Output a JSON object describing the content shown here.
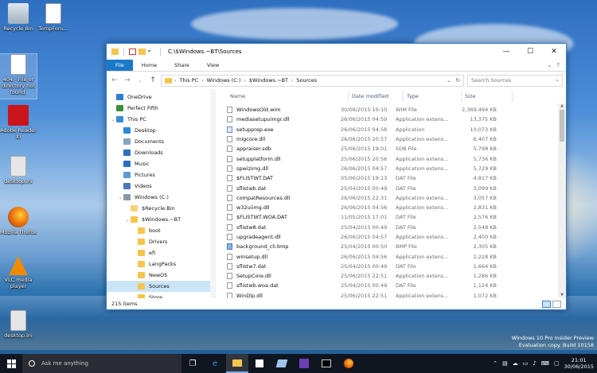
{
  "desktop": {
    "icons": [
      {
        "label": "Recycle Bin",
        "icon": "recycle-bin-icon"
      },
      {
        "label": "TempForu...",
        "icon": "text-document-icon"
      },
      {
        "label": "404 - File or directory not found.",
        "icon": "text-document-icon"
      },
      {
        "label": "Adobe Reader XI",
        "icon": "adobe-reader-icon"
      },
      {
        "label": "desktop.ini",
        "icon": "settings-file-icon"
      },
      {
        "label": "Mozilla Firefox",
        "icon": "firefox-icon"
      },
      {
        "label": "VLC media player",
        "icon": "vlc-icon"
      },
      {
        "label": "desktop.ini",
        "icon": "settings-file-icon"
      }
    ]
  },
  "window": {
    "title": "C:\\$Windows.~BT\\Sources",
    "controls": {
      "minimize": "—",
      "maximize": "☐",
      "close": "✕"
    },
    "ribbon_tabs": [
      "File",
      "Home",
      "Share",
      "View"
    ],
    "address": {
      "crumbs": [
        "This PC",
        "Windows (C:)",
        "$Windows.~BT",
        "Sources"
      ],
      "search_placeholder": "Search Sources"
    },
    "nav_pane": [
      {
        "label": "OneDrive",
        "level": 0,
        "icon": "onedrive-icon",
        "color": "#2d7dd2"
      },
      {
        "label": "Perfect Fifth",
        "level": 0,
        "icon": "user-icon",
        "color": "#3a8f3a"
      },
      {
        "label": "This PC",
        "level": 0,
        "icon": "computer-icon",
        "color": "#3b8bd8"
      },
      {
        "label": "Desktop",
        "level": 1,
        "icon": "desktop-icon",
        "color": "#2a8ad8"
      },
      {
        "label": "Documents",
        "level": 1,
        "icon": "documents-icon",
        "color": "#8aa4bf"
      },
      {
        "label": "Downloads",
        "level": 1,
        "icon": "downloads-icon",
        "color": "#2b6fc2"
      },
      {
        "label": "Music",
        "level": 1,
        "icon": "music-icon",
        "color": "#2b6fc2"
      },
      {
        "label": "Pictures",
        "level": 1,
        "icon": "pictures-icon",
        "color": "#5b9bd8"
      },
      {
        "label": "Videos",
        "level": 1,
        "icon": "videos-icon",
        "color": "#4a78b8"
      },
      {
        "label": "Windows (C:)",
        "level": 1,
        "icon": "drive-icon",
        "color": "#8a9aab"
      },
      {
        "label": "$Recycle.Bin",
        "level": 2,
        "icon": "folder-icon",
        "color": "#f5d27a"
      },
      {
        "label": "$Windows.~BT",
        "level": 2,
        "icon": "folder-icon",
        "color": "#f5c54c"
      },
      {
        "label": "boot",
        "level": 3,
        "icon": "folder-icon",
        "color": "#f5c54c"
      },
      {
        "label": "Drivers",
        "level": 3,
        "icon": "folder-icon",
        "color": "#f5c54c"
      },
      {
        "label": "efi",
        "level": 3,
        "icon": "folder-icon",
        "color": "#f5c54c"
      },
      {
        "label": "LangPacks",
        "level": 3,
        "icon": "folder-icon",
        "color": "#f5c54c"
      },
      {
        "label": "NewOS",
        "level": 3,
        "icon": "folder-icon",
        "color": "#f5c54c"
      },
      {
        "label": "Sources",
        "level": 3,
        "icon": "folder-icon",
        "color": "#f5c54c",
        "selected": true
      },
      {
        "label": "Store",
        "level": 3,
        "icon": "folder-icon",
        "color": "#f5c54c"
      }
    ],
    "columns": [
      "Name",
      "Date modified",
      "Type",
      "Size"
    ],
    "files": [
      {
        "name": "WindowsOld.wim",
        "date": "30/06/2015 10:10",
        "type": "WIM File",
        "size": "2,369,494 KB",
        "kind": "file"
      },
      {
        "name": "mediasetupuimgr.dll",
        "date": "26/06/2015 04:59",
        "type": "Application extens...",
        "size": "13,375 KB",
        "kind": "file"
      },
      {
        "name": "setupprep.exe",
        "date": "26/06/2015 04:58",
        "type": "Application",
        "size": "10,073 KB",
        "kind": "exe"
      },
      {
        "name": "migcore.dll",
        "date": "26/06/2015 20:57",
        "type": "Application extens...",
        "size": "6,407 KB",
        "kind": "file"
      },
      {
        "name": "appraiser.sdb",
        "date": "25/06/2015 19:01",
        "type": "SDB File",
        "size": "5,798 KB",
        "kind": "file"
      },
      {
        "name": "setupplatform.dll",
        "date": "25/06/2015 20:56",
        "type": "Application extens...",
        "size": "5,736 KB",
        "kind": "file"
      },
      {
        "name": "spwizimg.dll",
        "date": "26/06/2015 04:57",
        "type": "Application extens...",
        "size": "5,729 KB",
        "kind": "file"
      },
      {
        "name": "$FLISTWT.DAT",
        "date": "05/06/2015 19:13",
        "type": "DAT File",
        "size": "4,817 KB",
        "kind": "file"
      },
      {
        "name": "sflistwb.dat",
        "date": "25/04/2015 00:49",
        "type": "DAT File",
        "size": "3,099 KB",
        "kind": "file"
      },
      {
        "name": "compatResources.dll",
        "date": "26/06/2015 22:31",
        "type": "Application extens...",
        "size": "3,057 KB",
        "kind": "file"
      },
      {
        "name": "w32uiimg.dll",
        "date": "26/06/2015 04:56",
        "type": "Application extens...",
        "size": "2,831 KB",
        "kind": "file"
      },
      {
        "name": "$FLISTWT.WOA.DAT",
        "date": "11/05/2015 17:01",
        "type": "DAT File",
        "size": "2,576 KB",
        "kind": "file"
      },
      {
        "name": "sflistw8.dat",
        "date": "25/04/2015 00:49",
        "type": "DAT File",
        "size": "2,548 KB",
        "kind": "file"
      },
      {
        "name": "upgradeagent.dll",
        "date": "26/06/2015 04:57",
        "type": "Application extens...",
        "size": "2,400 KB",
        "kind": "file"
      },
      {
        "name": "background_cli.bmp",
        "date": "25/04/2015 00:50",
        "type": "BMP File",
        "size": "2,305 KB",
        "kind": "img"
      },
      {
        "name": "winsetup.dll",
        "date": "26/06/2015 04:56",
        "type": "Application extens...",
        "size": "2,228 KB",
        "kind": "file"
      },
      {
        "name": "sflistw7.dat",
        "date": "25/04/2015 00:49",
        "type": "DAT File",
        "size": "1,664 KB",
        "kind": "file"
      },
      {
        "name": "SetupCore.dll",
        "date": "25/06/2015 22:51",
        "type": "Application extens...",
        "size": "1,286 KB",
        "kind": "file"
      },
      {
        "name": "sflistwb.woa.dat",
        "date": "25/04/2015 00:49",
        "type": "DAT File",
        "size": "1,124 KB",
        "kind": "file"
      },
      {
        "name": "WinDlp.dll",
        "date": "25/06/2015 22:51",
        "type": "Application extens...",
        "size": "1,072 KB",
        "kind": "file"
      }
    ],
    "status": "215 items"
  },
  "taskbar": {
    "search_placeholder": "Ask me anything",
    "watermark_line1": "Windows 10 Pro Insider Preview",
    "watermark_line2": "Evaluation copy. Build 10158",
    "time": "21:01",
    "date": "30/06/2015"
  }
}
